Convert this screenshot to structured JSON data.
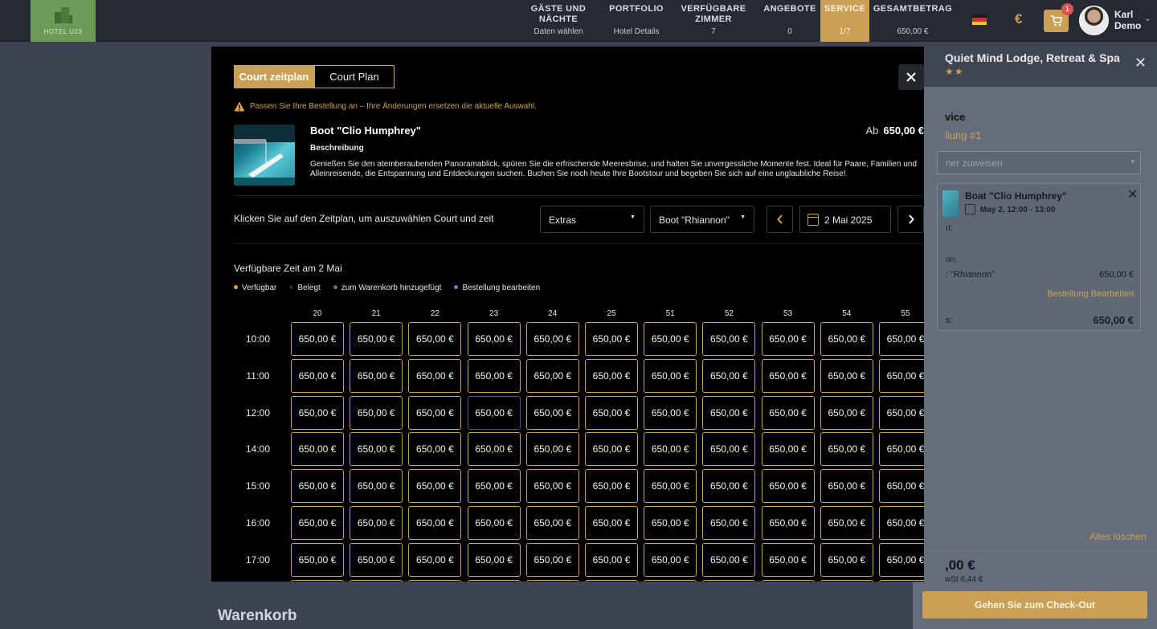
{
  "topbar": {
    "logo_text": "HOTEL U23",
    "nav": [
      {
        "title": "GÄSTE UND\nNÄCHTE",
        "sub": "Daten wählen"
      },
      {
        "title": "PORTFOLIO",
        "sub": "Hotel Details"
      },
      {
        "title": "VERFÜGBARE\nZIMMER",
        "sub": "7"
      },
      {
        "title": "ANGEBOTE",
        "sub": "0"
      },
      {
        "title": "SERVICE",
        "sub": "1/7"
      },
      {
        "title": "GESAMTBETRAG",
        "sub": "650,00 €"
      }
    ],
    "currency": "€",
    "cart_count": "1",
    "user_first": "Karl",
    "user_last": "Demo"
  },
  "side_panel": {
    "title": "Quiet Mind Lodge, Retreat & Spa",
    "stars": "★★",
    "service_label": "vice",
    "order_label": "llung #1",
    "assign_placeholder": "ner zuweisen",
    "item_name": "Boat \"Clio Humphrey\"",
    "item_date": "May 2, 12:00 - 13:00",
    "item_line1": "rt:",
    "item_line2": "on:",
    "item_line3": ": \"Rhiannon\"",
    "item_line3_value": "650,00 €",
    "edit_link": "Bestellung Bearbeiten",
    "item_line4": "s:",
    "item_line4_value": "650,00 €",
    "clear_all": "Alles löschen",
    "total": ",00 €",
    "vat": "wSt 6,44 €",
    "checkout": "Gehen Sie zum Check-Out"
  },
  "background": {
    "warenkorb": "Warenkorb"
  },
  "modal": {
    "tab_active": "Court zeitplan",
    "tab_inactive": "Court Plan",
    "warning": "Passen Sie Ihre Bestellung an – Ihre Änderungen ersetzen die aktuelle Auswahl.",
    "title": "Boot \"Clio Humphrey\"",
    "price_prefix": "Ab",
    "price": "650,00 €",
    "desc_title": "Beschreibung",
    "description": "Genießen Sie den atemberaubenden Panoramablick, spüren Sie die erfrischende Meeresbrise, und halten Sie unvergessliche Momente fest. Ideal für Paare, Familien und Alleinreisende, die Entspannung und Entdeckungen suchen. Buchen Sie noch heute Ihre Bootstour und begeben Sie sich auf eine unglaubliche Reise!",
    "pick_label": "Klicken Sie auf den Zeitplan, um auszuwählen Court und zeit",
    "dropdown_category": "Extras",
    "dropdown_court": "Boot \"Rhiannon\"",
    "date": "2 Mai 2025",
    "avail_title": "Verfügbare Zeit am 2 Mai",
    "legend": [
      {
        "label": "Verfügbar",
        "color": "#e0a24a"
      },
      {
        "label": "Belegt",
        "color": "#2a2a2a"
      },
      {
        "label": "zum Warenkorb hinzugefügt",
        "color": "#8a6a3a"
      },
      {
        "label": "Bestellung bearbeiten",
        "color": "#4a8fd0"
      }
    ],
    "columns": [
      "20",
      "21",
      "22",
      "23",
      "24",
      "25",
      "51",
      "52",
      "53",
      "54",
      "55"
    ],
    "rows": [
      "10:00",
      "11:00",
      "12:00",
      "14:00",
      "15:00",
      "16:00",
      "17:00"
    ],
    "slot_price": "650,00 €",
    "selected_slot": {
      "row": "12:00",
      "column": "23"
    }
  },
  "colors": {
    "accent": "#c9a056",
    "modal_bg": "#000000",
    "selected_border": "#2f5f8f"
  }
}
